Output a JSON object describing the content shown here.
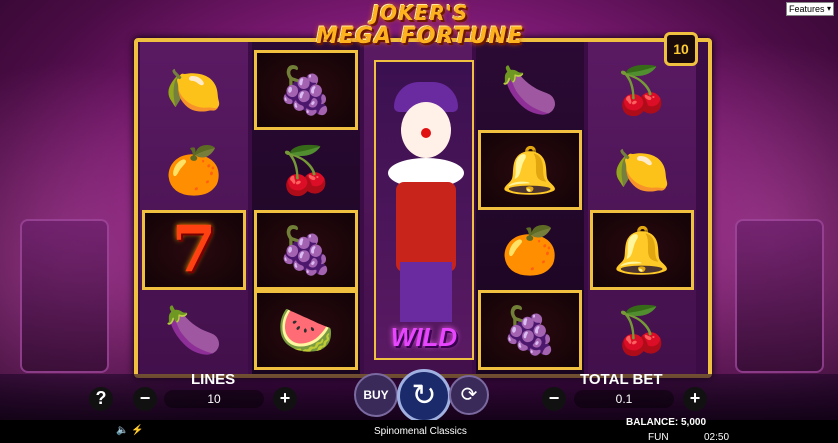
{
  "features_select": "Features",
  "logo": {
    "line1": "JOKER'S",
    "line2": "MEGA FORTUNE"
  },
  "lines_badge": "10",
  "wild_label": "WILD",
  "symbols": {
    "lemon": "🍋",
    "orange": "🍊",
    "plum": "🍆",
    "grapes": "🍇",
    "cherry": "🍒",
    "watermelon": "🍉",
    "bell": "🔔",
    "seven": "7"
  },
  "controls": {
    "help": "?",
    "lines_label": "LINES",
    "lines_value": "10",
    "minus": "−",
    "plus": "+",
    "buy": "BUY",
    "spin": "↻",
    "autoplay": "⟳",
    "total_bet_label": "TOTAL BET",
    "total_bet_value": "0.1"
  },
  "footer": {
    "sound_icon": "🔈",
    "speed_icon": "⚡",
    "brand": "Spinomenal Classics",
    "balance": "BALANCE: 5,000",
    "mode": "FUN",
    "time": "02:50"
  }
}
